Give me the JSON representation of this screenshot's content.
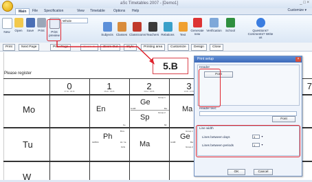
{
  "window": {
    "title": "aSc Timetables 2007 - [Demo1]",
    "controls": "_ □ ×"
  },
  "ribbon_tabs": [
    "Main",
    "File",
    "Specification",
    "View",
    "Timetable",
    "Options",
    "Help"
  ],
  "customize": "Customize ▾",
  "ribbon": {
    "filter_value": "Whole",
    "buttons": {
      "new": "New",
      "open": "Open",
      "save": "Save",
      "print": "Print",
      "print_preview": "Print preview",
      "subjects": "Subjects",
      "classes": "Classes",
      "classrooms": "Classrooms",
      "teachers": "Teachers",
      "relations": "Relations",
      "text": "Text",
      "generate": "Generate new",
      "verification": "Verification",
      "school": "School",
      "questions": "Questions? Comments? Write us"
    }
  },
  "toolbar": [
    "Print",
    "Next Page",
    "Prev Page",
    "Zoom In",
    "Zoom Out",
    "Style",
    "Printing area",
    "Customize",
    "Design",
    "Close"
  ],
  "sheet": {
    "register_label": "Please register",
    "periods": [
      {
        "num": "0",
        "time": "07:30 - 08:15"
      },
      {
        "num": "1",
        "time": "08:20 - 09:05"
      },
      {
        "num": "2",
        "time": "09:10 - 09:55"
      },
      {
        "num": "3",
        "time": "10:05 - 10:50"
      }
    ],
    "edge_period": "7",
    "days": [
      "Mo",
      "Tu",
      "W"
    ],
    "cells": {
      "mo1_subj": "En",
      "mo1_room": "Fe",
      "mo2_group1": "Group 1",
      "mo2_subj_a": "Ge",
      "mo2_room": "G108",
      "mo2_teacher": "Bw",
      "mo2_group2": "Group 2",
      "mo2_subj_b": "Sp",
      "mo2_code": "Mt",
      "mo3_subj": "Ma",
      "tu1_top": "Brcs",
      "tu1_subj": "Ph",
      "tu1_room": "GR504",
      "tu1_teacher": "Hl / Je",
      "tu1_grp": "Girls",
      "tu2_subj": "Ma",
      "tu3_group1": "Group 1",
      "tu3_subj": "Ge",
      "tu3_room": "G108",
      "tu3_teacher": "Bw",
      "tu3_group2": "Group 2"
    }
  },
  "callout": {
    "class_name": "5.B"
  },
  "dialog": {
    "title": "Print setup",
    "close": "×",
    "header_group": "Header",
    "header_font": "Font",
    "header_text_label": "Header text:",
    "header_text_value": "",
    "header_text_font": "Font",
    "line_width_group": "Line width",
    "lines_days_label": "Lines between days",
    "lines_days_value": "3",
    "lines_periods_label": "Lines between periods",
    "lines_periods_value": "1",
    "ok": "OK",
    "cancel": "Cancel"
  },
  "colors": {
    "accent_red": "#e0232d",
    "dialog_title": "#3b68b8"
  }
}
